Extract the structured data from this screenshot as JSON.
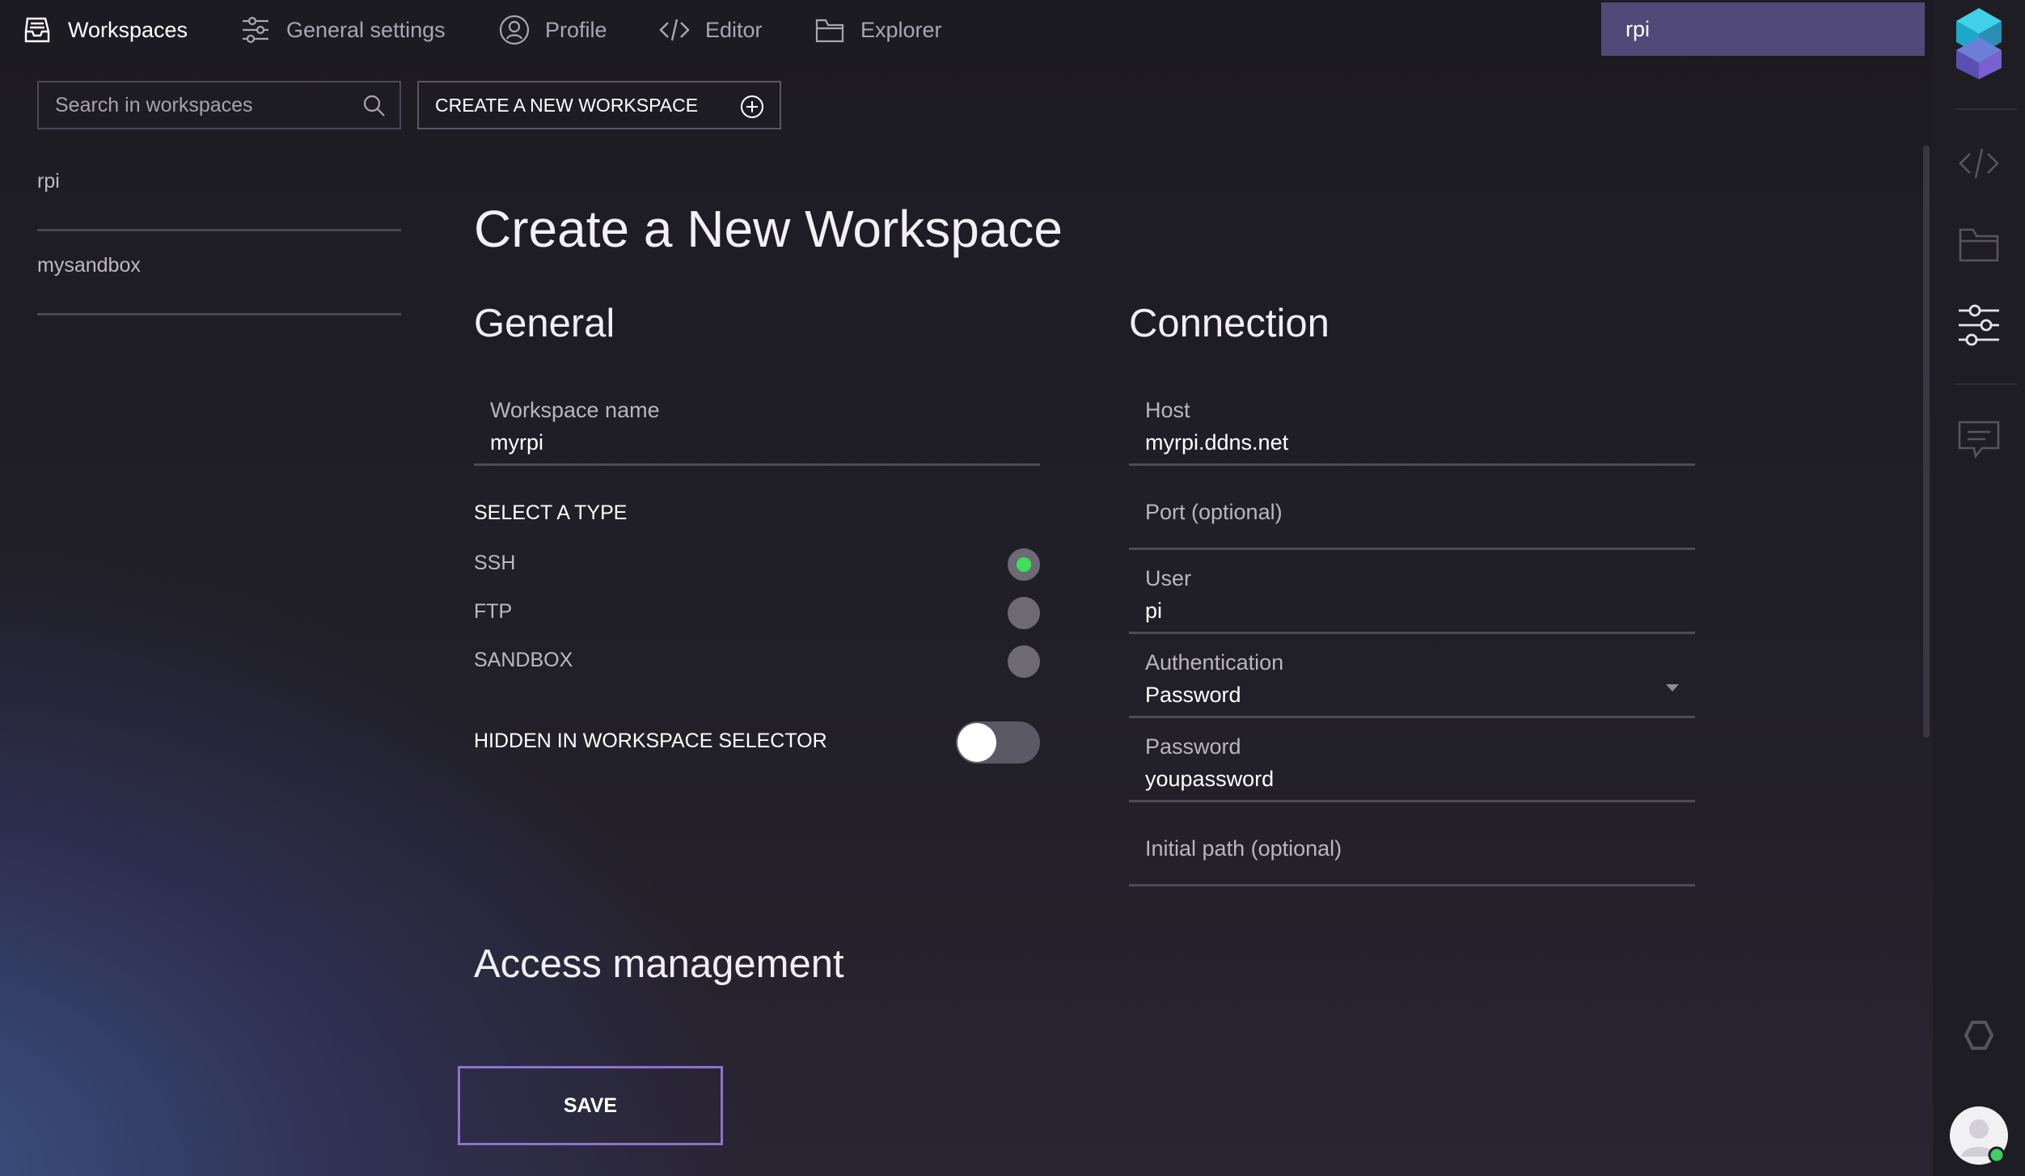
{
  "topnav": {
    "items": [
      {
        "label": "Workspaces",
        "icon": "workspaces-icon",
        "active": true
      },
      {
        "label": "General settings",
        "icon": "sliders-icon",
        "active": false
      },
      {
        "label": "Profile",
        "icon": "profile-icon",
        "active": false
      },
      {
        "label": "Editor",
        "icon": "code-icon",
        "active": false
      },
      {
        "label": "Explorer",
        "icon": "folder-icon",
        "active": false
      }
    ],
    "workspace_selector": "rpi"
  },
  "sidebar": {
    "search_placeholder": "Search in workspaces",
    "create_label": "CREATE A NEW WORKSPACE",
    "workspaces": [
      {
        "label": "rpi"
      },
      {
        "label": "mysandbox"
      }
    ]
  },
  "main": {
    "title": "Create a New Workspace",
    "general": {
      "heading": "General",
      "workspace_name_label": "Workspace name",
      "workspace_name_value": "myrpi",
      "select_type_heading": "SELECT A TYPE",
      "types": [
        {
          "label": "SSH",
          "checked": true
        },
        {
          "label": "FTP",
          "checked": false
        },
        {
          "label": "SANDBOX",
          "checked": false
        }
      ],
      "hidden_label": "HIDDEN IN WORKSPACE SELECTOR",
      "hidden_on": false
    },
    "connection": {
      "heading": "Connection",
      "host_label": "Host",
      "host_value": "myrpi.ddns.net",
      "port_label": "Port (optional)",
      "user_label": "User",
      "user_value": "pi",
      "auth_label": "Authentication",
      "auth_value": "Password",
      "password_label": "Password",
      "password_value": "youpassword",
      "initial_path_label": "Initial path (optional)"
    },
    "access_heading": "Access management",
    "save_label": "SAVE"
  },
  "colors": {
    "accent": "#514a78",
    "radio_checked": "#3ee05a",
    "save_border": "#8b74c9"
  }
}
